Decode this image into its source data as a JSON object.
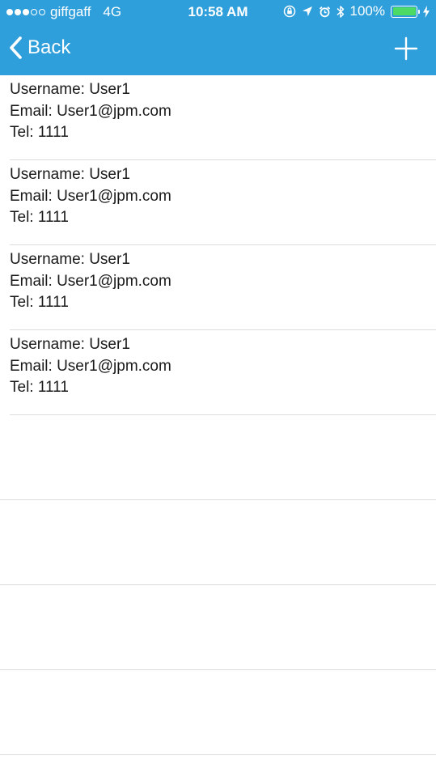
{
  "status_bar": {
    "carrier": "giffgaff",
    "network": "4G",
    "time": "10:58 AM",
    "battery": "100%",
    "signal_bars_filled": 3,
    "signal_bars_total": 5,
    "battery_level": 1.0
  },
  "nav": {
    "back_label": "Back"
  },
  "colors": {
    "nav_background": "#2f9fdb",
    "battery_fill": "#4cd964",
    "separator": "#dcdcdc"
  },
  "users": [
    {
      "username": "Username: User1",
      "email": "Email: User1@jpm.com",
      "tel": "Tel: 1111"
    },
    {
      "username": "Username: User1",
      "email": "Email: User1@jpm.com",
      "tel": "Tel: 1111"
    },
    {
      "username": "Username: User1",
      "email": "Email: User1@jpm.com",
      "tel": "Tel: 1111"
    },
    {
      "username": "Username: User1",
      "email": "Email: User1@jpm.com",
      "tel": "Tel: 1111"
    }
  ],
  "icons": {
    "back": "chevron-left-icon",
    "add": "plus-icon",
    "orientation_lock": "orientation-lock-icon",
    "location": "location-arrow-icon",
    "alarm": "alarm-clock-icon",
    "bluetooth": "bluetooth-icon",
    "charging": "charging-bolt-icon"
  }
}
